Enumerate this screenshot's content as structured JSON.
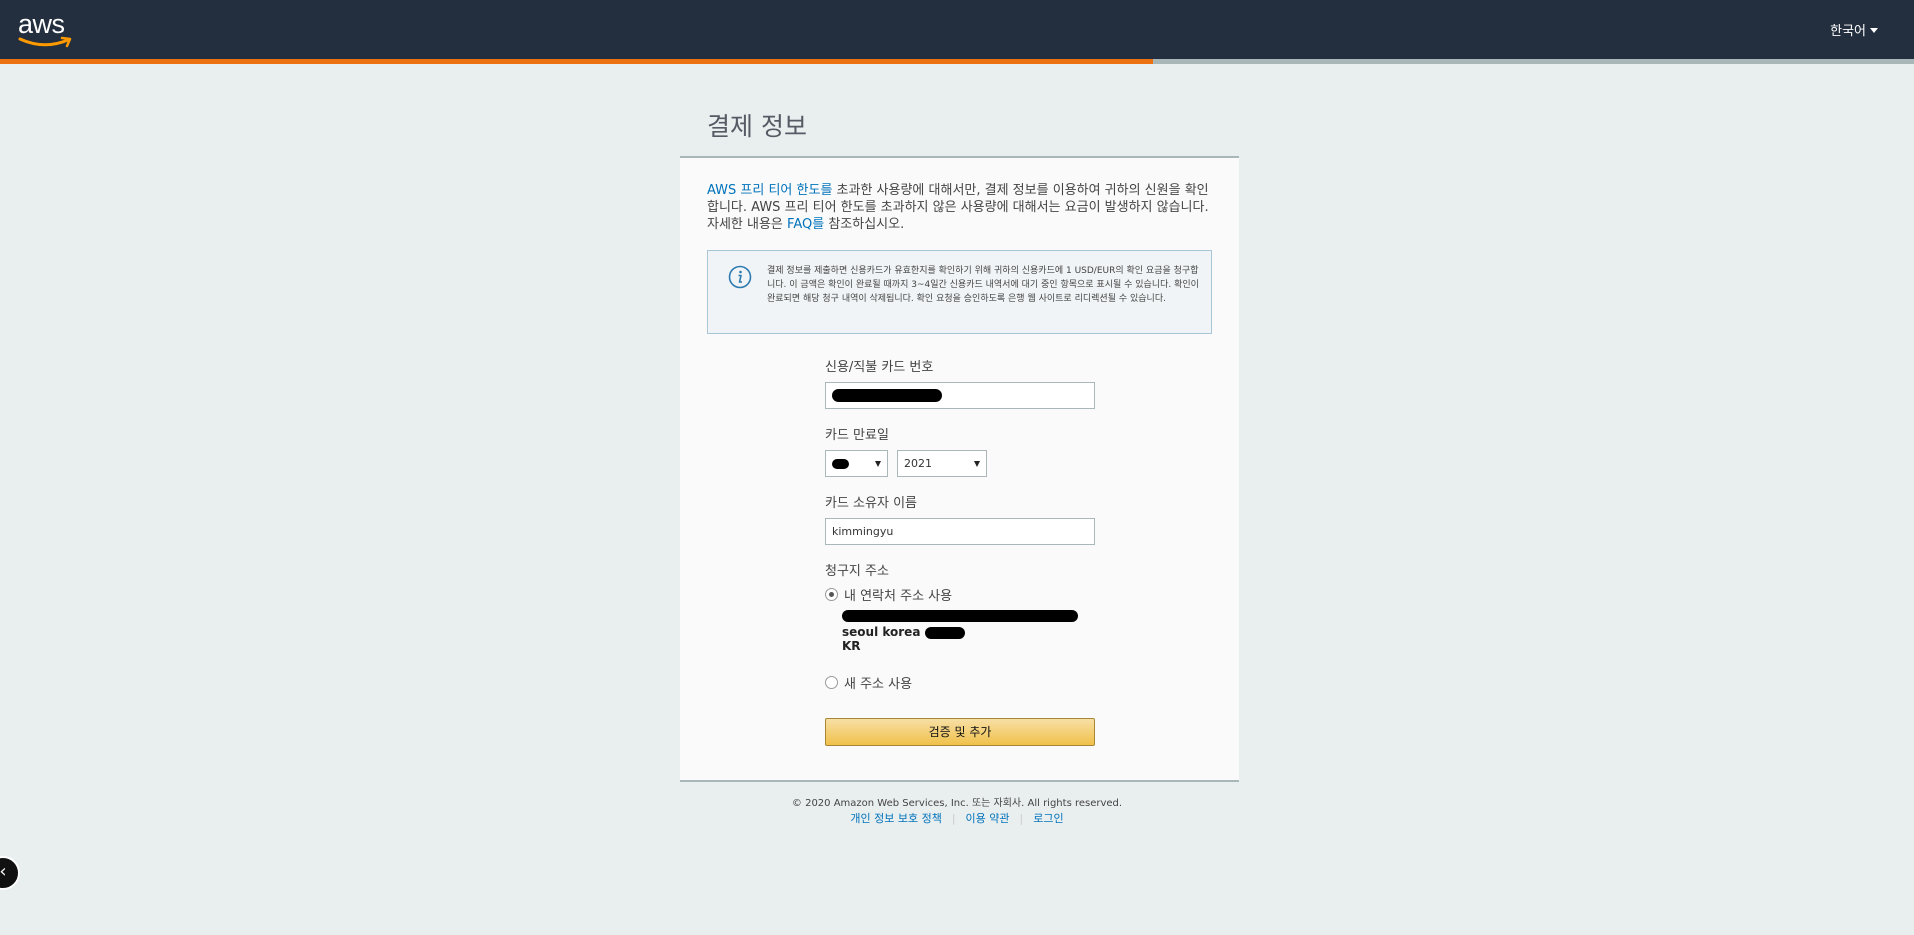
{
  "header": {
    "logo_text": "aws",
    "language": "한국어",
    "progress_fraction": 0.6025
  },
  "page": {
    "title": "결제 정보"
  },
  "intro": {
    "link1": "AWS 프리 티어 한도를",
    "text1": " 초과한 사용량에 대해서만, 결제 정보를 이용하여 귀하의 신원을 확인합니다. AWS 프리 티어 한도를 초과하지 않은 사용량에 대해서는 요금이 발생하지 않습니다. 자세한 내용은 ",
    "link2": "FAQ를",
    "text2": " 참조하십시오."
  },
  "info": {
    "text": "결제 정보를 제출하면 신용카드가 유효한지를 확인하기 위해 귀하의 신용카드에 1 USD/EUR의 확인 요금을 청구합니다. 이 금액은 확인이 완료될 때까지 3~4일간 신용카드 내역서에 대기 중인 항목으로 표시될 수 있습니다. 확인이 완료되면 해당 청구 내역이 삭제됩니다. 확인 요청을 승인하도록 은행 웹 사이트로 리디렉션될 수 있습니다."
  },
  "form": {
    "card_number_label": "신용/직불 카드 번호",
    "expiry_label": "카드 만료일",
    "expiry_year": "2021",
    "holder_label": "카드 소유자 이름",
    "holder_value": "kimmingyu",
    "billing_label": "청구지 주소",
    "use_contact_label": "내 연락처 주소 사용",
    "address_line2": "seoul korea",
    "address_line3": "KR",
    "new_address_label": "새 주소 사용",
    "submit_label": "검증 및 추가"
  },
  "footer": {
    "copyright": "© 2020 Amazon Web Services, Inc. 또는 자회사. All rights reserved.",
    "links": [
      "개인 정보 보호 정책",
      "이용 약관",
      "로그인"
    ]
  },
  "colors": {
    "header_bg": "#232f3e",
    "progress": "#ec7211",
    "link": "#0073bb",
    "button": "#f0c14b"
  }
}
